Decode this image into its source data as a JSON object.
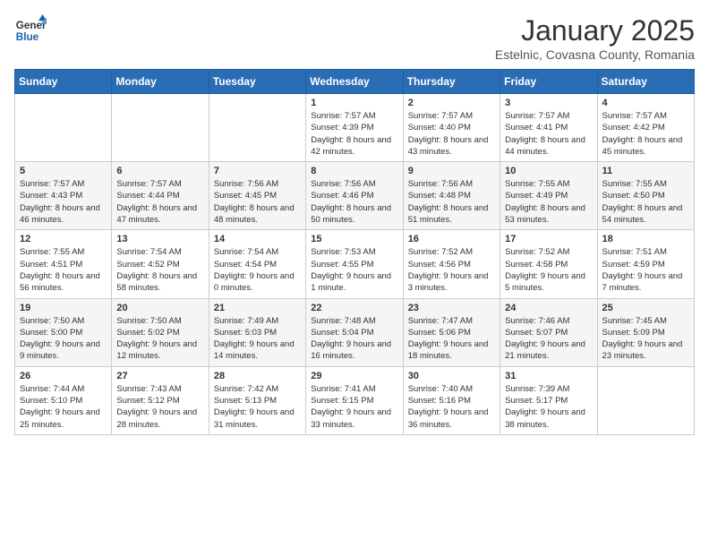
{
  "logo": {
    "general": "General",
    "blue": "Blue"
  },
  "header": {
    "month": "January 2025",
    "location": "Estelnic, Covasna County, Romania"
  },
  "weekdays": [
    "Sunday",
    "Monday",
    "Tuesday",
    "Wednesday",
    "Thursday",
    "Friday",
    "Saturday"
  ],
  "weeks": [
    [
      {
        "day": null
      },
      {
        "day": null
      },
      {
        "day": null
      },
      {
        "day": 1,
        "sunrise": "7:57 AM",
        "sunset": "4:39 PM",
        "daylight": "8 hours and 42 minutes."
      },
      {
        "day": 2,
        "sunrise": "7:57 AM",
        "sunset": "4:40 PM",
        "daylight": "8 hours and 43 minutes."
      },
      {
        "day": 3,
        "sunrise": "7:57 AM",
        "sunset": "4:41 PM",
        "daylight": "8 hours and 44 minutes."
      },
      {
        "day": 4,
        "sunrise": "7:57 AM",
        "sunset": "4:42 PM",
        "daylight": "8 hours and 45 minutes."
      }
    ],
    [
      {
        "day": 5,
        "sunrise": "7:57 AM",
        "sunset": "4:43 PM",
        "daylight": "8 hours and 46 minutes."
      },
      {
        "day": 6,
        "sunrise": "7:57 AM",
        "sunset": "4:44 PM",
        "daylight": "8 hours and 47 minutes."
      },
      {
        "day": 7,
        "sunrise": "7:56 AM",
        "sunset": "4:45 PM",
        "daylight": "8 hours and 48 minutes."
      },
      {
        "day": 8,
        "sunrise": "7:56 AM",
        "sunset": "4:46 PM",
        "daylight": "8 hours and 50 minutes."
      },
      {
        "day": 9,
        "sunrise": "7:56 AM",
        "sunset": "4:48 PM",
        "daylight": "8 hours and 51 minutes."
      },
      {
        "day": 10,
        "sunrise": "7:55 AM",
        "sunset": "4:49 PM",
        "daylight": "8 hours and 53 minutes."
      },
      {
        "day": 11,
        "sunrise": "7:55 AM",
        "sunset": "4:50 PM",
        "daylight": "8 hours and 54 minutes."
      }
    ],
    [
      {
        "day": 12,
        "sunrise": "7:55 AM",
        "sunset": "4:51 PM",
        "daylight": "8 hours and 56 minutes."
      },
      {
        "day": 13,
        "sunrise": "7:54 AM",
        "sunset": "4:52 PM",
        "daylight": "8 hours and 58 minutes."
      },
      {
        "day": 14,
        "sunrise": "7:54 AM",
        "sunset": "4:54 PM",
        "daylight": "9 hours and 0 minutes."
      },
      {
        "day": 15,
        "sunrise": "7:53 AM",
        "sunset": "4:55 PM",
        "daylight": "9 hours and 1 minute."
      },
      {
        "day": 16,
        "sunrise": "7:52 AM",
        "sunset": "4:56 PM",
        "daylight": "9 hours and 3 minutes."
      },
      {
        "day": 17,
        "sunrise": "7:52 AM",
        "sunset": "4:58 PM",
        "daylight": "9 hours and 5 minutes."
      },
      {
        "day": 18,
        "sunrise": "7:51 AM",
        "sunset": "4:59 PM",
        "daylight": "9 hours and 7 minutes."
      }
    ],
    [
      {
        "day": 19,
        "sunrise": "7:50 AM",
        "sunset": "5:00 PM",
        "daylight": "9 hours and 9 minutes."
      },
      {
        "day": 20,
        "sunrise": "7:50 AM",
        "sunset": "5:02 PM",
        "daylight": "9 hours and 12 minutes."
      },
      {
        "day": 21,
        "sunrise": "7:49 AM",
        "sunset": "5:03 PM",
        "daylight": "9 hours and 14 minutes."
      },
      {
        "day": 22,
        "sunrise": "7:48 AM",
        "sunset": "5:04 PM",
        "daylight": "9 hours and 16 minutes."
      },
      {
        "day": 23,
        "sunrise": "7:47 AM",
        "sunset": "5:06 PM",
        "daylight": "9 hours and 18 minutes."
      },
      {
        "day": 24,
        "sunrise": "7:46 AM",
        "sunset": "5:07 PM",
        "daylight": "9 hours and 21 minutes."
      },
      {
        "day": 25,
        "sunrise": "7:45 AM",
        "sunset": "5:09 PM",
        "daylight": "9 hours and 23 minutes."
      }
    ],
    [
      {
        "day": 26,
        "sunrise": "7:44 AM",
        "sunset": "5:10 PM",
        "daylight": "9 hours and 25 minutes."
      },
      {
        "day": 27,
        "sunrise": "7:43 AM",
        "sunset": "5:12 PM",
        "daylight": "9 hours and 28 minutes."
      },
      {
        "day": 28,
        "sunrise": "7:42 AM",
        "sunset": "5:13 PM",
        "daylight": "9 hours and 31 minutes."
      },
      {
        "day": 29,
        "sunrise": "7:41 AM",
        "sunset": "5:15 PM",
        "daylight": "9 hours and 33 minutes."
      },
      {
        "day": 30,
        "sunrise": "7:40 AM",
        "sunset": "5:16 PM",
        "daylight": "9 hours and 36 minutes."
      },
      {
        "day": 31,
        "sunrise": "7:39 AM",
        "sunset": "5:17 PM",
        "daylight": "9 hours and 38 minutes."
      },
      {
        "day": null
      }
    ]
  ]
}
